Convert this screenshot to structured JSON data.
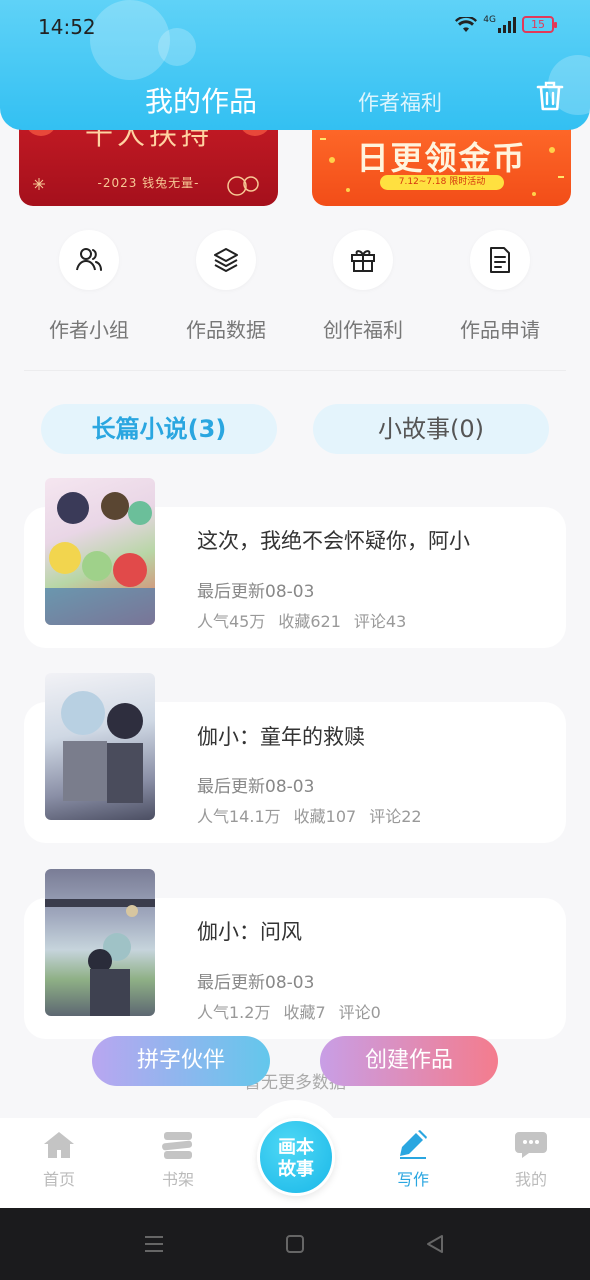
{
  "status_bar": {
    "time": "14:52",
    "network": "4G",
    "battery": "15"
  },
  "header": {
    "tab_active": "我的作品",
    "tab_secondary": "作者福利",
    "delete_icon": "trash-icon"
  },
  "banners": [
    {
      "title": "千人扶持",
      "subtitle": "-2023 钱兔无量-"
    },
    {
      "title": "日更领金币",
      "subtitle": "7.12~7.18 限时活动"
    }
  ],
  "quick_actions": [
    {
      "label": "作者小组",
      "icon": "people-icon"
    },
    {
      "label": "作品数据",
      "icon": "layers-icon"
    },
    {
      "label": "创作福利",
      "icon": "gift-icon"
    },
    {
      "label": "作品申请",
      "icon": "document-icon"
    }
  ],
  "categories": [
    {
      "label": "长篇小说(3)",
      "active": true
    },
    {
      "label": "小故事(0)",
      "active": false
    }
  ],
  "works": [
    {
      "title": "这次，我绝不会怀疑你，阿小",
      "updated": "最后更新08-03",
      "popularity": "人气45万",
      "favorites": "收藏621",
      "comments": "评论43"
    },
    {
      "title": "伽小：童年的救赎",
      "updated": "最后更新08-03",
      "popularity": "人气14.1万",
      "favorites": "收藏107",
      "comments": "评论22"
    },
    {
      "title": "伽小：问风",
      "updated": "最后更新08-03",
      "popularity": "人气1.2万",
      "favorites": "收藏7",
      "comments": "评论0"
    }
  ],
  "no_more": "暂无更多数据",
  "floating_buttons": {
    "left": "拼字伙伴",
    "right": "创建作品"
  },
  "bottom_nav": {
    "items": [
      {
        "label": "首页",
        "icon": "home-icon"
      },
      {
        "label": "书架",
        "icon": "bookshelf-icon"
      },
      {
        "label": "写作",
        "icon": "pen-icon"
      },
      {
        "label": "我的",
        "icon": "chat-bubble-icon"
      }
    ],
    "center_line1": "画本",
    "center_line2": "故事"
  },
  "colors": {
    "accent": "#2aa6e0",
    "header": "#33c0f2"
  }
}
